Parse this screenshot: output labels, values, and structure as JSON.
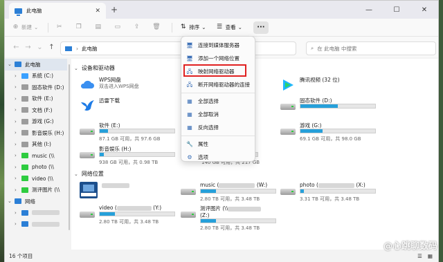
{
  "window": {
    "tab_title": "此电脑",
    "tab_close": "✕",
    "new_tab": "+",
    "controls": {
      "minimize": "—",
      "maximize": "☐",
      "close": "✕"
    }
  },
  "toolbar": {
    "new_label": "新建",
    "new_chevron": "⌄",
    "sort_label": "排序",
    "view_label": "查看",
    "more_label": "···"
  },
  "address": {
    "path": "此电脑",
    "chevron": "›",
    "search_placeholder": "在 此电脑 中搜索"
  },
  "sidebar": {
    "items": [
      {
        "label": "此电脑",
        "expanded": true,
        "color": "#2b7fd6"
      },
      {
        "label": "系统 (C:)",
        "color": "#3aa0ff"
      },
      {
        "label": "固态软件 (D:)",
        "color": "#9c9c9c"
      },
      {
        "label": "软件 (E:)",
        "color": "#9c9c9c"
      },
      {
        "label": "文档 (F:)",
        "color": "#9c9c9c"
      },
      {
        "label": "游戏 (G:)",
        "color": "#9c9c9c"
      },
      {
        "label": "影音娱乐 (H:)",
        "color": "#9c9c9c"
      },
      {
        "label": "其他 (I:)",
        "color": "#9c9c9c"
      },
      {
        "label": "music (\\\\",
        "color": "#2ecc40"
      },
      {
        "label": "photo (\\\\",
        "color": "#2ecc40"
      },
      {
        "label": "video (\\\\",
        "color": "#2ecc40"
      },
      {
        "label": "测评图片 (\\\\",
        "color": "#2ecc40"
      },
      {
        "label": "网络",
        "expanded": true,
        "color": "#2b7fd6"
      },
      {
        "label": "",
        "color": "#2b7fd6"
      },
      {
        "label": "",
        "color": "#2b7fd6"
      }
    ]
  },
  "sections": {
    "devices": "设备和驱动器",
    "network": "网络位置"
  },
  "devices": [
    {
      "name": "WPS网盘",
      "free": "双击进入WPS网盘",
      "kind": "cloud"
    },
    {
      "name": "腾讯视频 (32 位)",
      "kind": "tencent"
    },
    {
      "name": "迅雷下载",
      "kind": "xunlei"
    },
    {
      "name": "固态软件 (D:)",
      "free": "",
      "fill": 0.5,
      "kind": "disk"
    },
    {
      "name": "软件 (E:)",
      "free": "87.1 GB 可用，共 97.6 GB",
      "fill": 0.11,
      "kind": "disk"
    },
    {
      "name": "游戏 (G:)",
      "free": "69.1 GB 可用，共 98.0 GB",
      "fill": 0.3,
      "kind": "disk"
    },
    {
      "name": "影音娱乐 (H:)",
      "free": "938 GB 可用，共 0.98 TB",
      "fill": 0.06,
      "kind": "disk"
    },
    {
      "name": "",
      "free": "140 GB 可用，共 217 GB",
      "fill": 0.36,
      "kind": "disk"
    }
  ],
  "network": [
    {
      "name": "",
      "free": "",
      "kind": "synology"
    },
    {
      "name": "music (",
      "suffix": " (W:)",
      "free": "2.80 TB 可用，共 3.48 TB",
      "fill": 0.2,
      "kind": "net"
    },
    {
      "name": "photo (",
      "suffix": " (X:)",
      "free": "3.31 TB 可用，共 3.48 TB",
      "fill": 0.05,
      "kind": "net"
    },
    {
      "name": "video (",
      "suffix": " (Y:)",
      "free": "2.80 TB 可用，共 3.48 TB",
      "fill": 0.2,
      "kind": "net"
    },
    {
      "name": "测评图片 (\\\\",
      "suffix": "(Z:)",
      "free": "2.80 TB 可用，共 3.48 TB",
      "fill": 0.2,
      "kind": "net"
    }
  ],
  "menu": {
    "items": [
      {
        "label": "连接到媒体服务器",
        "icon": "🖥"
      },
      {
        "label": "添加一个网络位置",
        "icon": "🖥"
      },
      {
        "label": "映射网络驱动器",
        "icon": "🖧"
      },
      {
        "label": "断开网络驱动器的连接",
        "icon": "🖧"
      },
      {
        "label": "全部选择",
        "icon": "▦"
      },
      {
        "label": "全部取消",
        "icon": "▦"
      },
      {
        "label": "反向选择",
        "icon": "▦"
      },
      {
        "label": "属性",
        "icon": "🔧"
      },
      {
        "label": "选项",
        "icon": "⚙"
      }
    ],
    "highlight_color": "#e02020"
  },
  "status": {
    "count": "16 个项目"
  },
  "watermark": "@心跳聊数码"
}
